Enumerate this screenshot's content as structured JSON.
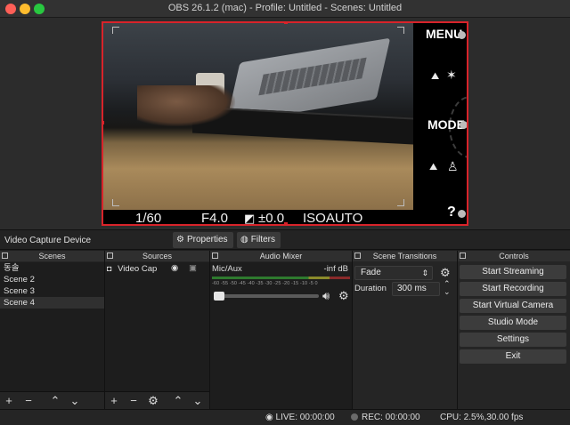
{
  "window": {
    "title": "OBS 26.1.2 (mac) - Profile: Untitled - Scenes: Untitled"
  },
  "preview": {
    "osd": {
      "shutter": "1/60",
      "aperture": "F4.0",
      "exposure": "±0.0",
      "iso": "ISOAUTO",
      "menu": "MENU",
      "mode": "MODE",
      "help": "?"
    }
  },
  "toolbar": {
    "source_name": "Video Capture Device",
    "properties_label": "Properties",
    "filters_label": "Filters"
  },
  "scenes": {
    "title": "Scenes",
    "items": [
      "동솔",
      "Scene 2",
      "Scene 3",
      "Scene 4"
    ],
    "selected_index": 3
  },
  "sources": {
    "title": "Sources",
    "items": [
      {
        "name": "Video Cap"
      }
    ]
  },
  "mixer": {
    "title": "Audio Mixer",
    "channel_name": "Mic/Aux",
    "level": "-inf dB",
    "scale": [
      "-60",
      "-55",
      "-50",
      "-45",
      "-40",
      "-35",
      "-30",
      "-25",
      "-20",
      "-15",
      "-10",
      "-5",
      "0"
    ]
  },
  "transitions": {
    "title": "Scene Transitions",
    "type": "Fade",
    "duration_label": "Duration",
    "duration_value": "300 ms"
  },
  "controls": {
    "title": "Controls",
    "start_streaming": "Start Streaming",
    "start_recording": "Start Recording",
    "start_virtual_camera": "Start Virtual Camera",
    "studio_mode": "Studio Mode",
    "settings": "Settings",
    "exit": "Exit"
  },
  "status": {
    "live": "LIVE: 00:00:00",
    "rec": "REC: 00:00:00",
    "cpu": "CPU: 2.5%,30.00 fps"
  },
  "colors": {
    "accent_red": "#d8232a",
    "panel_bg": "#1d1d1d",
    "button_bg": "#3c3c3c"
  }
}
